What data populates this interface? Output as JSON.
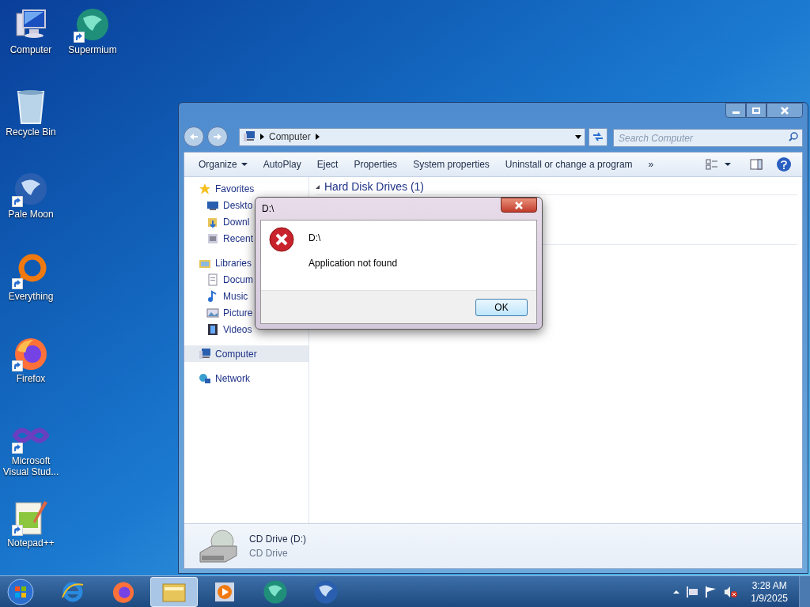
{
  "desktop_icons": [
    {
      "label": "Computer",
      "shortcut": false
    },
    {
      "label": "Supermium",
      "shortcut": true
    },
    {
      "label": "Recycle Bin",
      "shortcut": false
    },
    {
      "label": "Pale Moon",
      "shortcut": true
    },
    {
      "label": "Everything",
      "shortcut": true
    },
    {
      "label": "Firefox",
      "shortcut": true
    },
    {
      "label": "Microsoft Visual Stud...",
      "shortcut": true
    },
    {
      "label": "Notepad++",
      "shortcut": true
    }
  ],
  "window": {
    "address": [
      "Computer"
    ],
    "search": {
      "placeholder": "Search Computer"
    },
    "toolbar": [
      {
        "label": "Organize",
        "dropdown": true
      },
      {
        "label": "AutoPlay",
        "dropdown": false
      },
      {
        "label": "Eject",
        "dropdown": false
      },
      {
        "label": "Properties",
        "dropdown": false
      },
      {
        "label": "System properties",
        "dropdown": false
      },
      {
        "label": "Uninstall or change a program",
        "dropdown": false
      },
      {
        "label": "»",
        "dropdown": false
      }
    ],
    "nav": [
      {
        "label": "Favorites",
        "selected": false,
        "children": [
          {
            "label": "Deskto",
            "selected": false
          },
          {
            "label": "Downl",
            "selected": false
          },
          {
            "label": "Recent",
            "selected": false
          }
        ]
      },
      {
        "label": "Libraries",
        "selected": false,
        "children": [
          {
            "label": "Docum",
            "selected": false
          },
          {
            "label": "Music",
            "selected": false
          },
          {
            "label": "Picture",
            "selected": false
          },
          {
            "label": "Videos",
            "selected": false
          }
        ]
      },
      {
        "label": "Computer",
        "selected": true
      },
      {
        "label": "Network",
        "selected": false
      }
    ],
    "group": {
      "title": "Hard Disk Drives (1)",
      "expanded": true
    },
    "details": {
      "name": "CD Drive (D:)",
      "type": "CD Drive"
    }
  },
  "dialog": {
    "title": "D:\\",
    "heading": "D:\\",
    "message": "Application not found",
    "button": "OK"
  },
  "taskbar": {
    "items": [
      {
        "selected": false
      },
      {
        "selected": false
      },
      {
        "selected": true
      },
      {
        "selected": false
      },
      {
        "selected": false
      },
      {
        "selected": false
      }
    ],
    "clock": {
      "time": "3:28 AM",
      "date": "1/9/2025"
    }
  }
}
